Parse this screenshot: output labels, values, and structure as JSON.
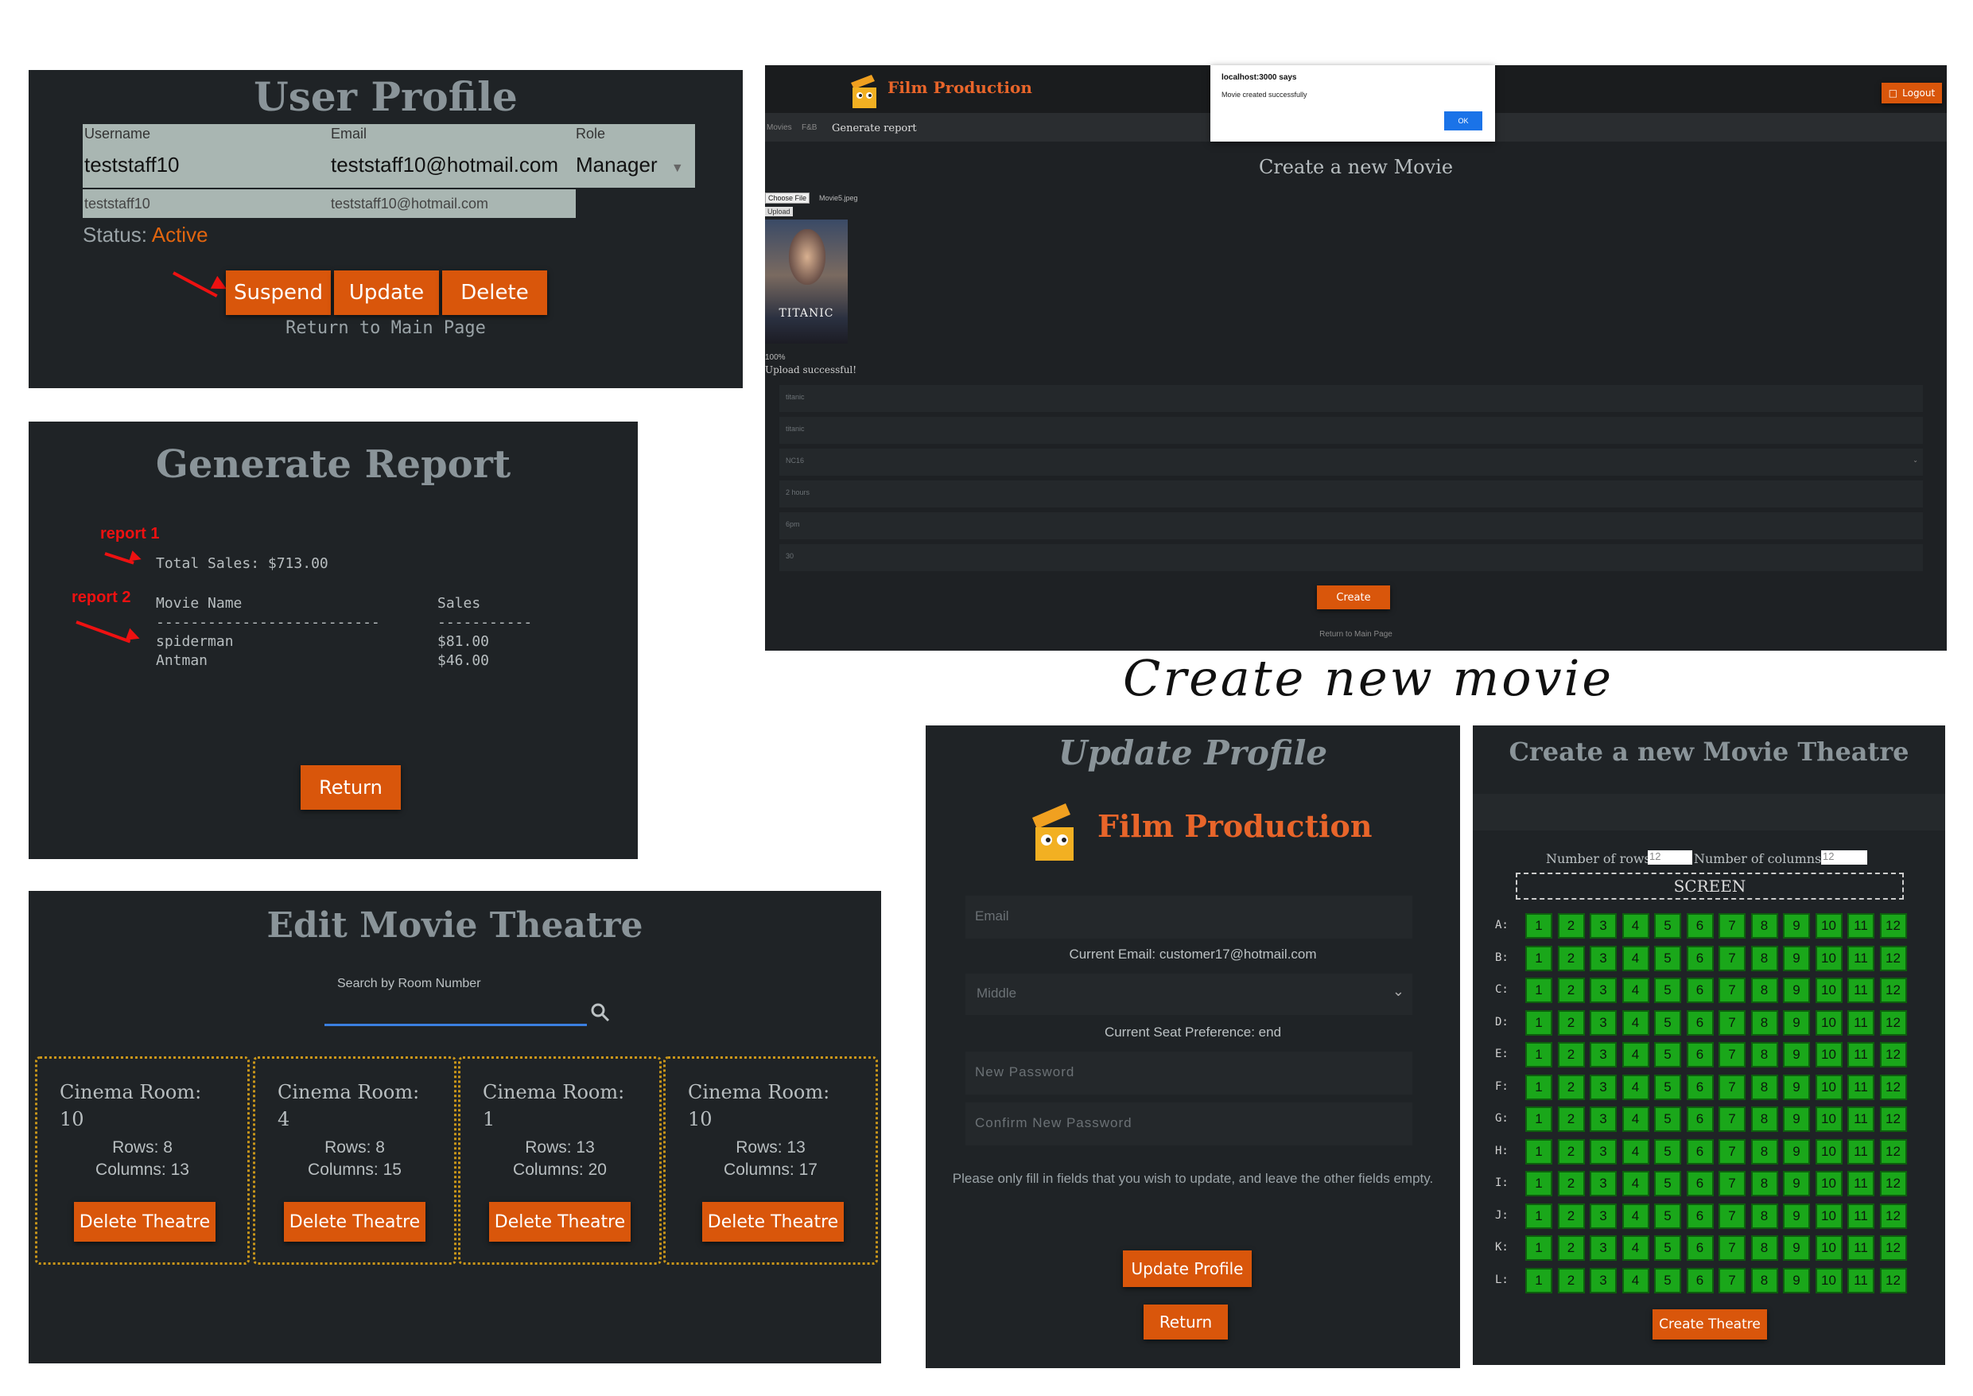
{
  "user_profile": {
    "title": "User Profile",
    "headers": [
      "Username",
      "Email",
      "Role"
    ],
    "username": "teststaff10",
    "email": "teststaff10@hotmail.com",
    "role": "Manager",
    "username_small": "teststaff10",
    "email_small": "teststaff10@hotmail.com",
    "status_label": "Status:",
    "status_value": "Active",
    "buttons": [
      "Suspend",
      "Update",
      "Delete"
    ],
    "return_link": "Return to Main Page"
  },
  "generate_report": {
    "title": "Generate Report",
    "annotation_1": "report 1",
    "annotation_2": "report 2",
    "total_sales": "Total Sales: $713.00",
    "col_movie": "Movie Name",
    "col_sales": "Sales",
    "separator_1": "--------------------------",
    "separator_2": "-----------",
    "rows": [
      {
        "movie": "spiderman",
        "sales": "$81.00"
      },
      {
        "movie": "Antman",
        "sales": "$46.00"
      }
    ],
    "return_button": "Return"
  },
  "edit_theatre": {
    "title": "Edit Movie Theatre",
    "search_placeholder": "Search by Room Number",
    "rooms": [
      {
        "label": "Cinema Room:",
        "number": "10",
        "rows": "Rows: 8",
        "cols": "Columns: 13"
      },
      {
        "label": "Cinema Room:",
        "number": "4",
        "rows": "Rows: 8",
        "cols": "Columns: 15"
      },
      {
        "label": "Cinema Room:",
        "number": "1",
        "rows": "Rows: 13",
        "cols": "Columns: 20"
      },
      {
        "label": "Cinema Room:",
        "number": "10",
        "rows": "Rows: 13",
        "cols": "Columns: 17"
      }
    ],
    "delete_label": "Delete Theatre"
  },
  "create_movie": {
    "brand": "Film Production",
    "logout": "Logout",
    "nav": [
      "Movies",
      "F&B",
      "Generate report"
    ],
    "dialog_origin": "localhost:3000 says",
    "dialog_message": "Movie created successfully",
    "dialog_ok": "OK",
    "title": "Create a new Movie",
    "choose_file": "Choose File",
    "file_name": "Movie5.jpeg",
    "upload": "Upload",
    "poster_text": "TITANIC",
    "progress": "100%",
    "upload_status": "Upload successful!",
    "fields": [
      "titanic",
      "titanic",
      "NC16",
      "2 hours",
      "6pm",
      "30"
    ],
    "create_button": "Create",
    "return_link": "Return to Main Page"
  },
  "caption": "Create new movie",
  "update_profile": {
    "title": "Update Profile",
    "brand": "Film Production",
    "email_placeholder": "Email",
    "current_email": "Current Email: customer17@hotmail.com",
    "seat_select": "Middle",
    "current_seat": "Current Seat Preference: end",
    "new_password": "New Password",
    "confirm_password": "Confirm New Password",
    "note": "Please only fill in fields that you wish to update, and leave the other fields empty.",
    "update_button": "Update Profile",
    "return_button": "Return"
  },
  "create_theatre": {
    "title": "Create a new Movie Theatre",
    "rows_label": "Number of rows:",
    "rows_value": "12",
    "cols_label": "Number of columns:",
    "cols_value": "12",
    "screen": "SCREEN",
    "row_letters": [
      "A:",
      "B:",
      "C:",
      "D:",
      "E:",
      "F:",
      "G:",
      "H:",
      "I:",
      "J:",
      "K:",
      "L:"
    ],
    "seat_numbers": [
      "1",
      "2",
      "3",
      "4",
      "5",
      "6",
      "7",
      "8",
      "9",
      "10",
      "11",
      "12"
    ],
    "create_button": "Create Theatre"
  },
  "colors": {
    "panel": "#1f2326",
    "accent": "#d9560b",
    "seat": "#1aa71a",
    "annotation": "#ee1111"
  }
}
